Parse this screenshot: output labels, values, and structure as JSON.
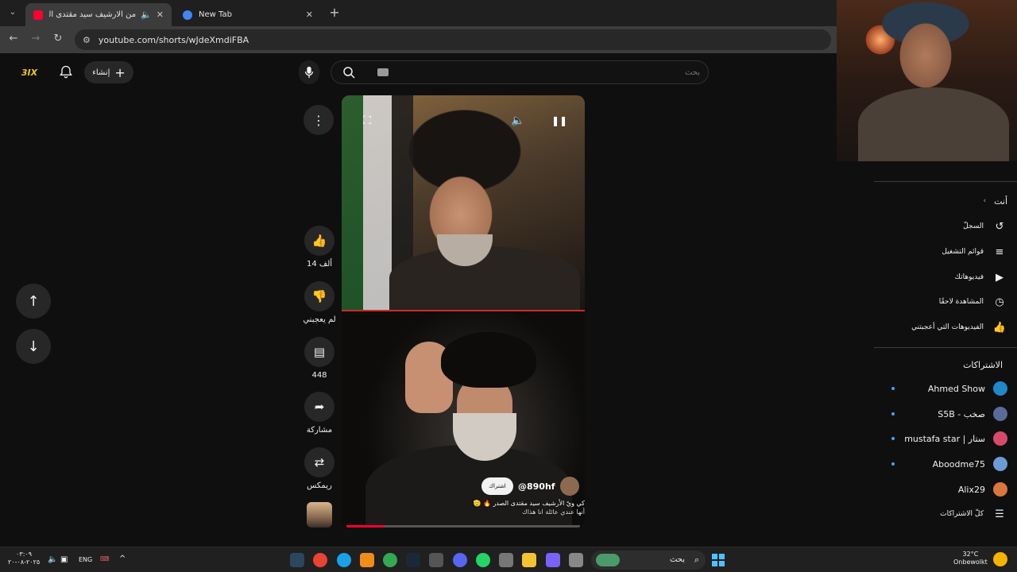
{
  "browser": {
    "tabs": [
      {
        "title": "من الارشيف سيد مقتدى الصد",
        "active": true
      },
      {
        "title": "New Tab",
        "active": false
      }
    ],
    "url": "youtube.com/shorts/wJdeXmdiFBA"
  },
  "header": {
    "logo_text": "3IX",
    "create_label": "إنشاء",
    "search_placeholder": "بحث"
  },
  "short": {
    "channel_handle": "@890hf",
    "subscribe_label": "اشتراك",
    "caption_line1": "كي ويّ الأرشيف سيد مقتدى الصدر 🔥 🫡",
    "caption_line2": "أنها عندي عائلة انا هذاك",
    "progress_percent": 16,
    "actions": {
      "likes": "14 ألف",
      "dislike_label": "لم يعجبني",
      "comments": "448",
      "share_label": "مشاركة",
      "remix_label": "ريمكس"
    }
  },
  "sidebar": {
    "you_section": {
      "heading": "أنت",
      "items": [
        {
          "label": "السجلّ",
          "icon": "history-icon"
        },
        {
          "label": "قوائم التشغيل",
          "icon": "playlist-icon"
        },
        {
          "label": "فيديوهاتك",
          "icon": "your-videos-icon"
        },
        {
          "label": "المشاهدة لاحقًا",
          "icon": "watch-later-icon"
        },
        {
          "label": "الفيديوهات التي أعجبتني",
          "icon": "liked-icon"
        }
      ]
    },
    "subscriptions": {
      "heading": "الاشتراكات",
      "items": [
        {
          "name": "Ahmed Show",
          "new": true,
          "color": "#1e88c8"
        },
        {
          "name": "S5B - صخب",
          "new": true,
          "color": "#5a6a9a"
        },
        {
          "name": "mustafa star | ستار",
          "new": true,
          "color": "#d84a6a"
        },
        {
          "name": "Aboodme75",
          "new": true,
          "color": "#6a9ad8"
        },
        {
          "name": "Alix29",
          "new": false,
          "color": "#d8783a"
        }
      ],
      "all_label": "كلّ الاشتراكات"
    }
  },
  "taskbar": {
    "time": "٠٣:٠٩",
    "date": "٢٠٢٥-٠٨-٢٠",
    "language": "ENG",
    "search_label": "بحث",
    "weather_temp": "32°C",
    "weather_desc": "Onbewolkt"
  }
}
